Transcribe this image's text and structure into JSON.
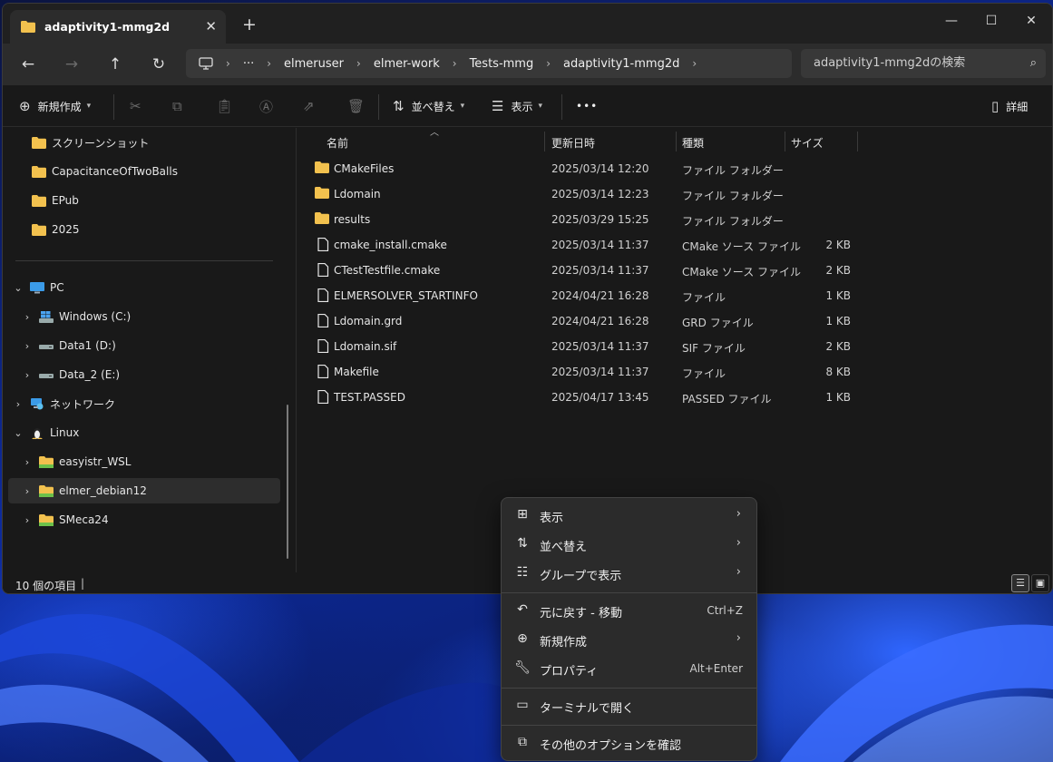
{
  "window": {
    "tab_title": "adaptivity1-mmg2d",
    "tab_close": "✕",
    "new_tab": "+",
    "minimize": "—",
    "maximize": "☐",
    "close": "✕"
  },
  "nav": {
    "back": "←",
    "forward": "→",
    "up": "↑",
    "refresh": "↻",
    "breadcrumbs": [
      "elmeruser",
      "elmer-work",
      "Tests-mmg",
      "adaptivity1-mmg2d"
    ],
    "more": "···",
    "search_placeholder": "adaptivity1-mmg2dの検索"
  },
  "toolbar": {
    "new_label": "新規作成",
    "sort_label": "並べ替え",
    "view_label": "表示",
    "more": "•••",
    "details_label": "詳細"
  },
  "sidebar": {
    "quick": [
      "スクリーンショット",
      "CapacitanceOfTwoBalls",
      "EPub",
      "2025"
    ],
    "pc": "PC",
    "drives": [
      "Windows (C:)",
      "Data1 (D:)",
      "Data_2 (E:)"
    ],
    "network": "ネットワーク",
    "linux": "Linux",
    "linux_items": [
      "easyistr_WSL",
      "elmer_debian12",
      "SMeca24"
    ]
  },
  "columns": {
    "name": "名前",
    "date": "更新日時",
    "type": "種類",
    "size": "サイズ"
  },
  "files": [
    {
      "name": "CMakeFiles",
      "date": "2025/03/14 12:20",
      "type": "ファイル フォルダー",
      "size": "",
      "kind": "folder"
    },
    {
      "name": "Ldomain",
      "date": "2025/03/14 12:23",
      "type": "ファイル フォルダー",
      "size": "",
      "kind": "folder"
    },
    {
      "name": "results",
      "date": "2025/03/29 15:25",
      "type": "ファイル フォルダー",
      "size": "",
      "kind": "folder"
    },
    {
      "name": "cmake_install.cmake",
      "date": "2025/03/14 11:37",
      "type": "CMake ソース ファイル",
      "size": "2 KB",
      "kind": "file"
    },
    {
      "name": "CTestTestfile.cmake",
      "date": "2025/03/14 11:37",
      "type": "CMake ソース ファイル",
      "size": "2 KB",
      "kind": "file"
    },
    {
      "name": "ELMERSOLVER_STARTINFO",
      "date": "2024/04/21 16:28",
      "type": "ファイル",
      "size": "1 KB",
      "kind": "file"
    },
    {
      "name": "Ldomain.grd",
      "date": "2024/04/21 16:28",
      "type": "GRD ファイル",
      "size": "1 KB",
      "kind": "file"
    },
    {
      "name": "Ldomain.sif",
      "date": "2025/03/14 11:37",
      "type": "SIF ファイル",
      "size": "2 KB",
      "kind": "file"
    },
    {
      "name": "Makefile",
      "date": "2025/03/14 11:37",
      "type": "ファイル",
      "size": "8 KB",
      "kind": "file"
    },
    {
      "name": "TEST.PASSED",
      "date": "2025/04/17 13:45",
      "type": "PASSED ファイル",
      "size": "1 KB",
      "kind": "file"
    }
  ],
  "status": {
    "count": "10 個の項目"
  },
  "context_menu": {
    "view": "表示",
    "sort": "並べ替え",
    "group": "グループで表示",
    "undo": "元に戻す - 移動",
    "undo_shortcut": "Ctrl+Z",
    "new": "新規作成",
    "properties": "プロパティ",
    "properties_shortcut": "Alt+Enter",
    "terminal": "ターミナルで開く",
    "more_options": "その他のオプションを確認"
  },
  "colors": {
    "folder": "#f2c14e",
    "accent": "#4c9aff"
  }
}
